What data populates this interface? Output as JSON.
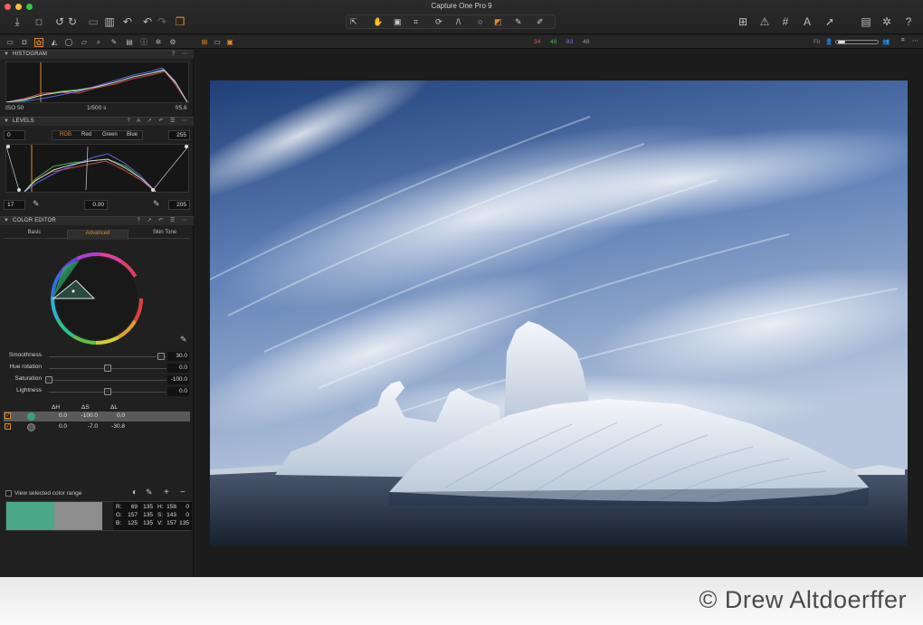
{
  "window": {
    "title": "Capture One Pro 9",
    "traffic_colors": [
      "#fc605c",
      "#fdbc40",
      "#34c84a"
    ]
  },
  "toolbar": {
    "left_icons": [
      "import-icon",
      "camera-icon",
      "rotate-left-icon",
      "rotate-right-icon",
      "copy-icon",
      "delete-icon",
      "undo-all-icon",
      "undo-icon",
      "redo-icon",
      "process-icon"
    ],
    "cursor_tools": [
      "select-icon",
      "pan-icon",
      "loupe-icon",
      "crop-icon",
      "rotate-icon",
      "keystone-icon",
      "spot-icon",
      "mask-icon",
      "picker-icon",
      "brush-icon"
    ],
    "right_icons": [
      "compare-icon",
      "warning-icon",
      "grid-icon",
      "text-icon",
      "share-icon",
      "print-icon",
      "settings-icon",
      "help-icon"
    ]
  },
  "subbar": {
    "channels": [
      {
        "label": "34",
        "color": "#e05a5a"
      },
      {
        "label": "49",
        "color": "#5ab45a"
      },
      {
        "label": "83",
        "color": "#7a7ae8"
      },
      {
        "label": "48",
        "color": "#9a9a9a"
      }
    ],
    "fit_label": "Fit",
    "accent": "#e08a2a"
  },
  "histogram": {
    "title": "HISTOGRAM",
    "iso": "ISO 50",
    "shutter": "1/500 s",
    "aperture": "f/5.6"
  },
  "levels": {
    "title": "LEVELS",
    "input_low": "0",
    "input_high": "255",
    "channels": [
      "RGB",
      "Red",
      "Green",
      "Blue"
    ],
    "active_channel": "RGB",
    "output_low": "17",
    "midpoint": "0.00",
    "output_high": "205"
  },
  "color_editor": {
    "title": "COLOR EDITOR",
    "tabs": [
      "Basic",
      "Advanced",
      "Skin Tone"
    ],
    "active_tab": "Advanced",
    "sliders": [
      {
        "label": "Smoothness",
        "value": "30.0",
        "position": 0.95
      },
      {
        "label": "Hue rotation",
        "value": "0.0",
        "position": 0.5
      },
      {
        "label": "Saturation",
        "value": "-100.0",
        "position": 0.0
      },
      {
        "label": "Lightness",
        "value": "0.0",
        "position": 0.5
      }
    ],
    "table_headers": [
      "ΔH",
      "ΔS",
      "ΔL"
    ],
    "rows": [
      {
        "swatch": "#3aa07a",
        "dh": "0.0",
        "ds": "-100.0",
        "dl": "0.0",
        "selected": true
      },
      {
        "swatch": "#555555",
        "dh": "0.0",
        "ds": "-7.0",
        "dl": "-30.8",
        "selected": false
      }
    ],
    "view_range_label": "View selected color range",
    "swatch_before": "#4aa888",
    "swatch_after": "#8d8d8d",
    "readout": {
      "r_label": "R:",
      "r1": "69",
      "r2": "135",
      "g_label": "G:",
      "g1": "157",
      "g2": "135",
      "b_label": "B:",
      "b1": "125",
      "b2": "135",
      "h_label": "H:",
      "h": "158",
      "h0": "0",
      "s_label": "S:",
      "s": "143",
      "s0": "0",
      "v_label": "V:",
      "v": "157",
      "v0": "135"
    }
  },
  "watermark": "© Drew Altdoerffer"
}
